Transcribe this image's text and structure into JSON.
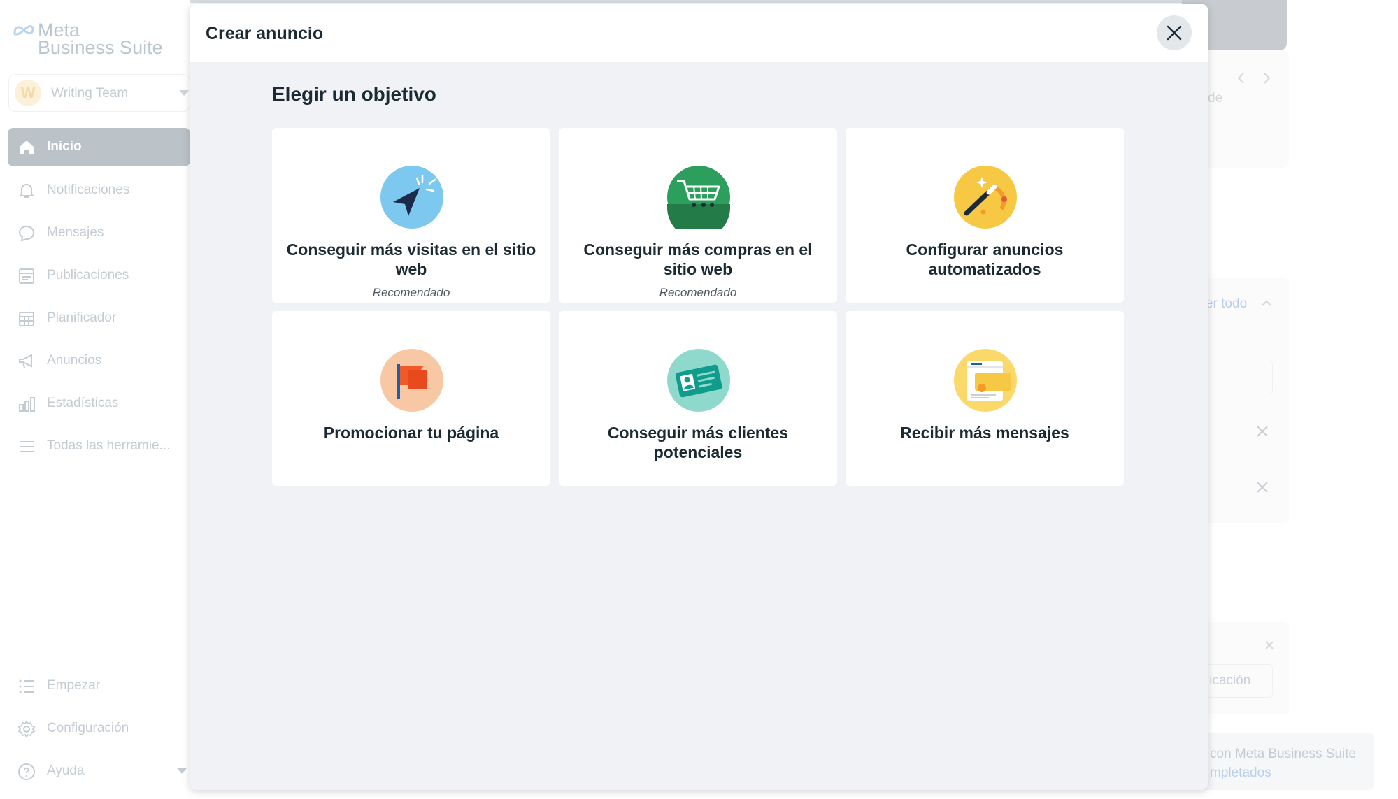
{
  "brand": {
    "line1": "Meta",
    "line2": "Business Suite"
  },
  "account": {
    "initial": "W",
    "name": "Writing Team"
  },
  "sidebar": {
    "items": [
      {
        "label": "Inicio",
        "icon": "home-icon",
        "active": true
      },
      {
        "label": "Notificaciones",
        "icon": "bell-icon"
      },
      {
        "label": "Mensajes",
        "icon": "chat-bubble-icon"
      },
      {
        "label": "Publicaciones",
        "icon": "posts-icon"
      },
      {
        "label": "Planificador",
        "icon": "calendar-grid-icon"
      },
      {
        "label": "Anuncios",
        "icon": "megaphone-icon"
      },
      {
        "label": "Estadísticas",
        "icon": "bar-chart-icon"
      },
      {
        "label": "Todas las herramie...",
        "icon": "menu-lines-icon"
      }
    ],
    "bottom_items": [
      {
        "label": "Empezar",
        "icon": "list-icon"
      },
      {
        "label": "Configuración",
        "icon": "gear-icon"
      },
      {
        "label": "Ayuda",
        "icon": "help-icon"
      }
    ]
  },
  "background": {
    "partial_de": "de",
    "see_all": "er todo",
    "placeholder_publicacion": "licación",
    "footer_line1": "con Meta Business Suite",
    "footer_line2": "mpletados"
  },
  "modal": {
    "title": "Crear anuncio",
    "section_title": "Elegir un objetivo",
    "objectives": [
      {
        "label": "Conseguir más visitas en el sitio web",
        "tag": "Recomendado",
        "icon": "cursor-click-icon"
      },
      {
        "label": "Conseguir más compras en el sitio web",
        "tag": "Recomendado",
        "icon": "shopping-cart-icon"
      },
      {
        "label": "Configurar anuncios automatizados",
        "tag": "",
        "icon": "magic-wand-icon"
      },
      {
        "label": "Promocionar tu página",
        "tag": "",
        "icon": "flag-icon"
      },
      {
        "label": "Conseguir más clientes potenciales",
        "tag": "",
        "icon": "contact-card-icon"
      },
      {
        "label": "Recibir más mensajes",
        "tag": "",
        "icon": "message-window-icon"
      }
    ]
  },
  "colors": {
    "accent_blue": "#0064e0",
    "active_nav_bg": "#bcc3c8",
    "modal_bg": "#f0f2f5",
    "text_dark": "#1c2b33"
  }
}
